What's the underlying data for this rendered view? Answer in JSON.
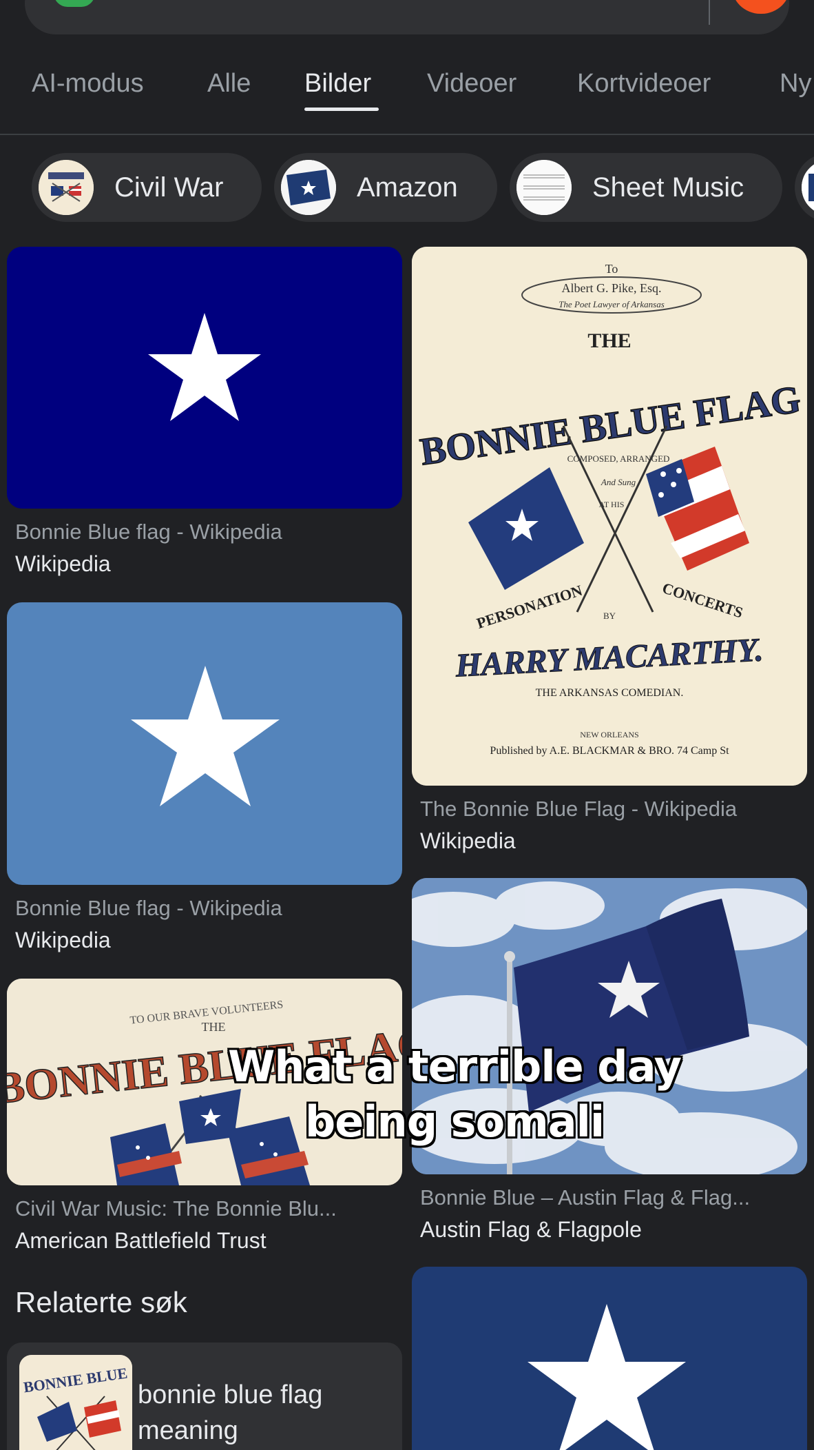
{
  "tabs": [
    {
      "label": "AI-modus"
    },
    {
      "label": "Alle"
    },
    {
      "label": "Bilder",
      "active": true
    },
    {
      "label": "Videoer"
    },
    {
      "label": "Kortvideoer"
    },
    {
      "label": "Ny"
    }
  ],
  "chips": [
    {
      "label": "Civil War",
      "icon": "sheet-music-thumb"
    },
    {
      "label": "Amazon",
      "icon": "flag-thumb"
    },
    {
      "label": "Sheet Music",
      "icon": "sheet-thumb"
    }
  ],
  "results": [
    {
      "title": "Bonnie Blue flag - Wikipedia",
      "source": "Wikipedia",
      "image": "dark-blue-star-flag"
    },
    {
      "title": "The Bonnie Blue Flag - Wikipedia",
      "source": "Wikipedia",
      "image": "sheet-music-cover"
    },
    {
      "title": "Bonnie Blue flag - Wikipedia",
      "source": "Wikipedia",
      "image": "light-blue-star-flag"
    },
    {
      "title": "Civil War Music: The Bonnie Blu...",
      "source": "American Battlefield Trust",
      "image": "sheet-music-cover-2"
    },
    {
      "title": "Bonnie Blue – Austin Flag & Flag...",
      "source": "Austin Flag & Flagpole",
      "image": "waving-flag-sky"
    },
    {
      "title": "",
      "source": "",
      "image": "blue-star-flag"
    }
  ],
  "sheet_music": {
    "to": "To",
    "dedication": "Albert G. Pike, Esq.",
    "dedication_sub": "The Poet Lawyer of Arkansas",
    "the": "THE",
    "title": "BONNIE BLUE FLAG",
    "composed": "COMPOSED, ARRANGED",
    "and_sung": "And Sung",
    "at_his": "AT HIS",
    "personation": "PERSONATION",
    "concerts": "CONCERTS",
    "by": "BY",
    "author": "HARRY MACARTHY.",
    "subtitle": "THE ARKANSAS COMEDIAN.",
    "city": "NEW ORLEANS",
    "publisher": "Published by A.E. BLACKMAR & BRO. 74 Camp St"
  },
  "sheet_music_2": {
    "header": "TO OUR BRAVE VOLUNTEERS",
    "the": "THE",
    "title": "BONNIE BLUE FLAG"
  },
  "related": {
    "heading": "Relaterte søk",
    "items": [
      {
        "label": "bonnie blue flag meaning"
      }
    ]
  },
  "overlay": "What a terrible day being somali",
  "colors": {
    "background": "#202124",
    "surface": "#303134",
    "flag_dark_blue": "#00007f",
    "flag_light_blue": "#5484bb",
    "flag_navy": "#1f3b73"
  }
}
